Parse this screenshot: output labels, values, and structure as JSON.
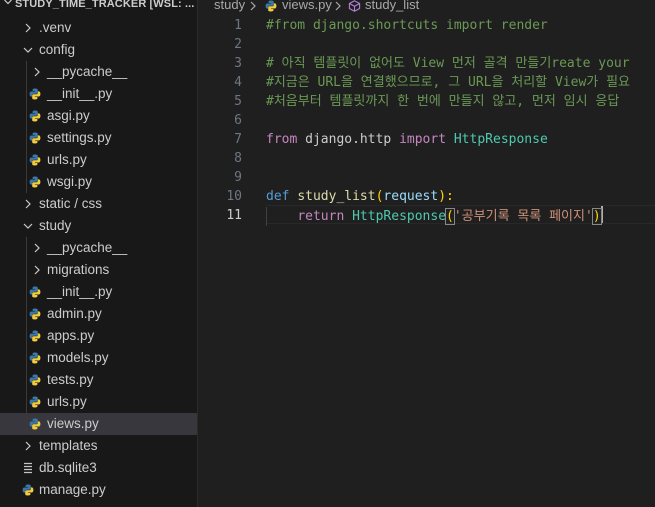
{
  "explorer": {
    "title": "STUDY_TIME_TRACKER [WSL: ...",
    "items": [
      {
        "label": ".venv",
        "kind": "folder",
        "expanded": false
      },
      {
        "label": "config",
        "kind": "folder",
        "expanded": true
      },
      {
        "label": "__pycache__",
        "kind": "folder",
        "expanded": false
      },
      {
        "label": "__init__.py",
        "kind": "python-file"
      },
      {
        "label": "asgi.py",
        "kind": "python-file"
      },
      {
        "label": "settings.py",
        "kind": "python-file"
      },
      {
        "label": "urls.py",
        "kind": "python-file"
      },
      {
        "label": "wsgi.py",
        "kind": "python-file"
      },
      {
        "label": "static / css",
        "kind": "folder",
        "expanded": false
      },
      {
        "label": "study",
        "kind": "folder",
        "expanded": true
      },
      {
        "label": "__pycache__",
        "kind": "folder",
        "expanded": false
      },
      {
        "label": "migrations",
        "kind": "folder",
        "expanded": false
      },
      {
        "label": "__init__.py",
        "kind": "python-file"
      },
      {
        "label": "admin.py",
        "kind": "python-file"
      },
      {
        "label": "apps.py",
        "kind": "python-file"
      },
      {
        "label": "models.py",
        "kind": "python-file"
      },
      {
        "label": "tests.py",
        "kind": "python-file"
      },
      {
        "label": "urls.py",
        "kind": "python-file"
      },
      {
        "label": "views.py",
        "kind": "python-file",
        "selected": true
      },
      {
        "label": "templates",
        "kind": "folder",
        "expanded": false
      },
      {
        "label": "db.sqlite3",
        "kind": "db-file"
      },
      {
        "label": "manage.py",
        "kind": "python-file"
      }
    ]
  },
  "breadcrumb": {
    "folder": "study",
    "file": "views.py",
    "symbol": "study_list"
  },
  "editor": {
    "active_line": 11,
    "lines": [
      {
        "n": "1",
        "tokens": [
          {
            "t": "#from django.shortcuts import render",
            "c": "comment"
          }
        ]
      },
      {
        "n": "2",
        "tokens": []
      },
      {
        "n": "3",
        "tokens": [
          {
            "t": "# 아직 템플릿이 없어도 View 먼저 골격 만들기reate your",
            "c": "comment"
          }
        ]
      },
      {
        "n": "4",
        "tokens": [
          {
            "t": "#지금은 URL을 연결했으므로, 그 URL을 처리할 View가 필요",
            "c": "comment"
          }
        ]
      },
      {
        "n": "5",
        "tokens": [
          {
            "t": "#처음부터 템플릿까지 한 번에 만들지 않고, 먼저 임시 응답",
            "c": "comment"
          }
        ]
      },
      {
        "n": "6",
        "tokens": []
      },
      {
        "n": "7",
        "tokens": [
          {
            "t": "from",
            "c": "kw"
          },
          {
            "t": " django.http ",
            "c": "plain"
          },
          {
            "t": "import",
            "c": "kw"
          },
          {
            "t": " HttpResponse",
            "c": "cls"
          }
        ]
      },
      {
        "n": "8",
        "tokens": []
      },
      {
        "n": "9",
        "tokens": []
      },
      {
        "n": "10",
        "tokens": [
          {
            "t": "def",
            "c": "def"
          },
          {
            "t": " ",
            "c": "plain"
          },
          {
            "t": "study_list",
            "c": "fn"
          },
          {
            "t": "(",
            "c": "paren"
          },
          {
            "t": "request",
            "c": "param"
          },
          {
            "t": "):",
            "c": "paren"
          }
        ]
      },
      {
        "n": "11",
        "tokens": [
          {
            "t": "    ",
            "c": "plain"
          },
          {
            "t": "return",
            "c": "kw"
          },
          {
            "t": " ",
            "c": "plain"
          },
          {
            "t": "HttpResponse",
            "c": "cls"
          },
          {
            "t": "(",
            "c": "paren-hl"
          },
          {
            "t": "'공부기록 목록 페이지'",
            "c": "str"
          },
          {
            "t": ")",
            "c": "paren-hl"
          }
        ]
      }
    ]
  },
  "colors": {
    "sidebar_bg": "#181818",
    "editor_bg": "#1f1f1f",
    "selected_row": "#37373d",
    "comment": "#6a9955",
    "keyword": "#c586c0",
    "function": "#dcdcaa",
    "string": "#ce9178",
    "class": "#4ec9b0"
  }
}
